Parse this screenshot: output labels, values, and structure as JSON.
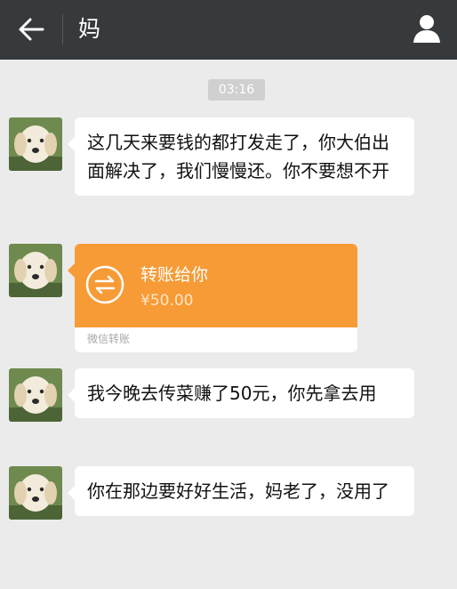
{
  "header": {
    "title": "妈",
    "back_icon": "arrow-left-icon",
    "profile_icon": "person-icon"
  },
  "timestamp": "03:16",
  "contact_avatar": "dog-avatar",
  "messages": [
    {
      "type": "text",
      "text": "这几天来要钱的都打发走了，你大伯出面解决了，我们慢慢还。你不要想不开"
    },
    {
      "type": "transfer",
      "label": "转账给你",
      "amount": "¥50.00",
      "footer": "微信转账",
      "accent": "#f79b36"
    },
    {
      "type": "text",
      "text": "我今晚去传菜赚了50元，你先拿去用"
    },
    {
      "type": "text",
      "text": "你在那边要好好生活，妈老了，没用了"
    }
  ]
}
